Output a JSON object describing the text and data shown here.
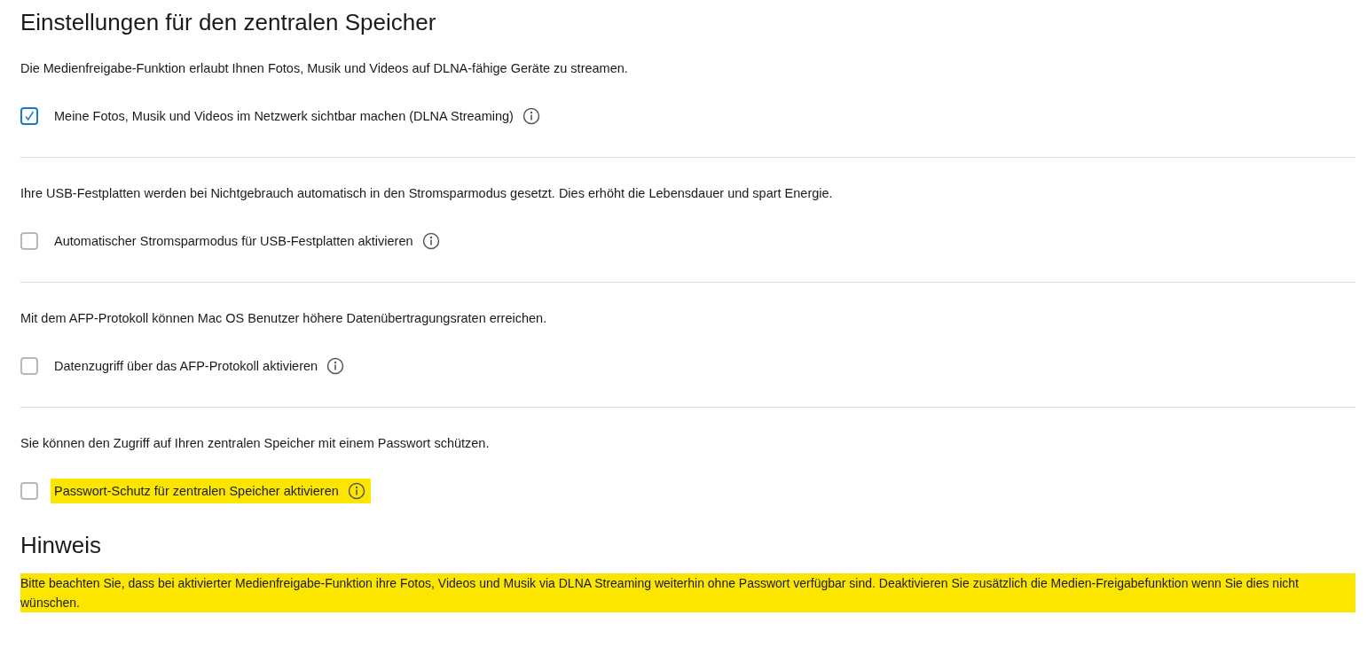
{
  "title": "Einstellungen für den zentralen Speicher",
  "sections": [
    {
      "description": "Die Medienfreigabe-Funktion erlaubt Ihnen Fotos, Musik und Videos auf DLNA-fähige Geräte zu streamen.",
      "option": {
        "label": "Meine Fotos, Musik und Videos im Netzwerk sichtbar machen (DLNA Streaming)",
        "checked": true,
        "highlighted": false
      }
    },
    {
      "description": "Ihre USB-Festplatten werden bei Nichtgebrauch automatisch in den Stromsparmodus gesetzt. Dies erhöht die Lebensdauer und spart Energie.",
      "option": {
        "label": "Automatischer Stromsparmodus für USB-Festplatten aktivieren",
        "checked": false,
        "highlighted": false
      }
    },
    {
      "description": "Mit dem AFP-Protokoll können Mac OS Benutzer höhere Datenübertragungsraten erreichen.",
      "option": {
        "label": "Datenzugriff über das AFP-Protokoll aktivieren",
        "checked": false,
        "highlighted": false
      }
    },
    {
      "description": "Sie können den Zugriff auf Ihren zentralen Speicher mit einem Passwort schützen.",
      "option": {
        "label": "Passwort-Schutz für zentralen Speicher aktivieren",
        "checked": false,
        "highlighted": true
      }
    }
  ],
  "note": {
    "heading": "Hinweis",
    "text": "Bitte beachten Sie, dass bei aktivierter Medienfreigabe-Funktion ihre Fotos, Videos und Musik via DLNA Streaming weiterhin ohne Passwort verfügbar sind. Deaktivieren Sie zusätzlich die Medien-Freigabefunktion wenn Sie dies nicht wünschen.",
    "highlighted": true
  }
}
